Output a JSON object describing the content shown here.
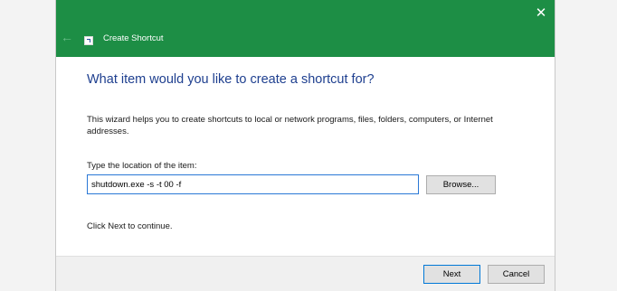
{
  "window": {
    "title": "Create Shortcut",
    "close_glyph": "✕",
    "back_glyph": "←",
    "accent_color": "#1d8e45",
    "icons": {
      "back": "back-arrow-icon",
      "app": "shortcut-app-icon",
      "close": "close-icon"
    }
  },
  "content": {
    "heading": "What item would you like to create a shortcut for?",
    "description": "This wizard helps you to create shortcuts to local or network programs, files, folders, computers, or Internet addresses.",
    "location_label": "Type the location of the item:",
    "location_value": "shutdown.exe -s -t 00 -f",
    "browse_label": "Browse...",
    "continue_text": "Click Next to continue."
  },
  "footer": {
    "next_label": "Next",
    "cancel_label": "Cancel"
  }
}
